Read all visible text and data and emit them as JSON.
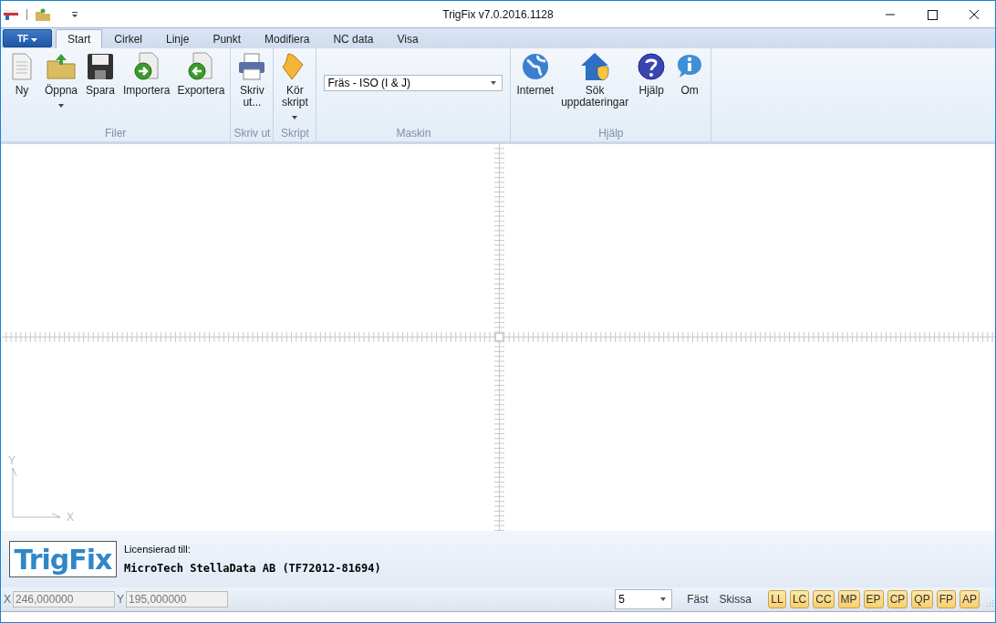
{
  "window": {
    "title": "TrigFix v7.0.2016.1128"
  },
  "app_menu": {
    "label": "TF"
  },
  "tabs": [
    {
      "label": "Start",
      "selected": true
    },
    {
      "label": "Cirkel",
      "selected": false
    },
    {
      "label": "Linje",
      "selected": false
    },
    {
      "label": "Punkt",
      "selected": false
    },
    {
      "label": "Modifiera",
      "selected": false
    },
    {
      "label": "NC data",
      "selected": false
    },
    {
      "label": "Visa",
      "selected": false
    }
  ],
  "ribbon_groups": [
    {
      "label": "Filer",
      "kind": "buttons",
      "buttons": [
        {
          "label": "Ny",
          "dropdown": false
        },
        {
          "label": "Öppna",
          "dropdown": true
        },
        {
          "label": "Spara",
          "dropdown": false
        },
        {
          "label": "Importera",
          "dropdown": false
        },
        {
          "label": "Exportera",
          "dropdown": false
        }
      ]
    },
    {
      "label": "Skriv ut",
      "kind": "buttons",
      "buttons": [
        {
          "label": "Skriv\nut...",
          "dropdown": false
        }
      ]
    },
    {
      "label": "Skript",
      "kind": "buttons",
      "buttons": [
        {
          "label": "Kör\nskript",
          "dropdown": true
        }
      ]
    },
    {
      "label": "Maskin",
      "kind": "dropdown",
      "value": "Fräs - ISO (I & J)"
    },
    {
      "label": "Hjälp",
      "kind": "buttons",
      "buttons": [
        {
          "label": "Internet",
          "dropdown": false
        },
        {
          "label": "Sök\nuppdateringar",
          "dropdown": false
        },
        {
          "label": "Hjälp",
          "dropdown": false
        },
        {
          "label": "Om",
          "dropdown": false
        }
      ]
    }
  ],
  "canvas": {
    "axis_y": "Y",
    "axis_x": "X"
  },
  "license": {
    "logo": "TrigFix",
    "label": "Licensierad till:",
    "holder": "MicroTech StellaData AB (TF72012-81694)"
  },
  "status_bar": {
    "x_label": "X",
    "x_value": "246,000000",
    "y_label": "Y",
    "y_value": "195,000000",
    "snap_value": "5",
    "modes": [
      "Fäst",
      "Skissa"
    ],
    "snap_buttons": [
      "LL",
      "LC",
      "CC",
      "MP",
      "EP",
      "CP",
      "QP",
      "FP",
      "AP"
    ]
  }
}
